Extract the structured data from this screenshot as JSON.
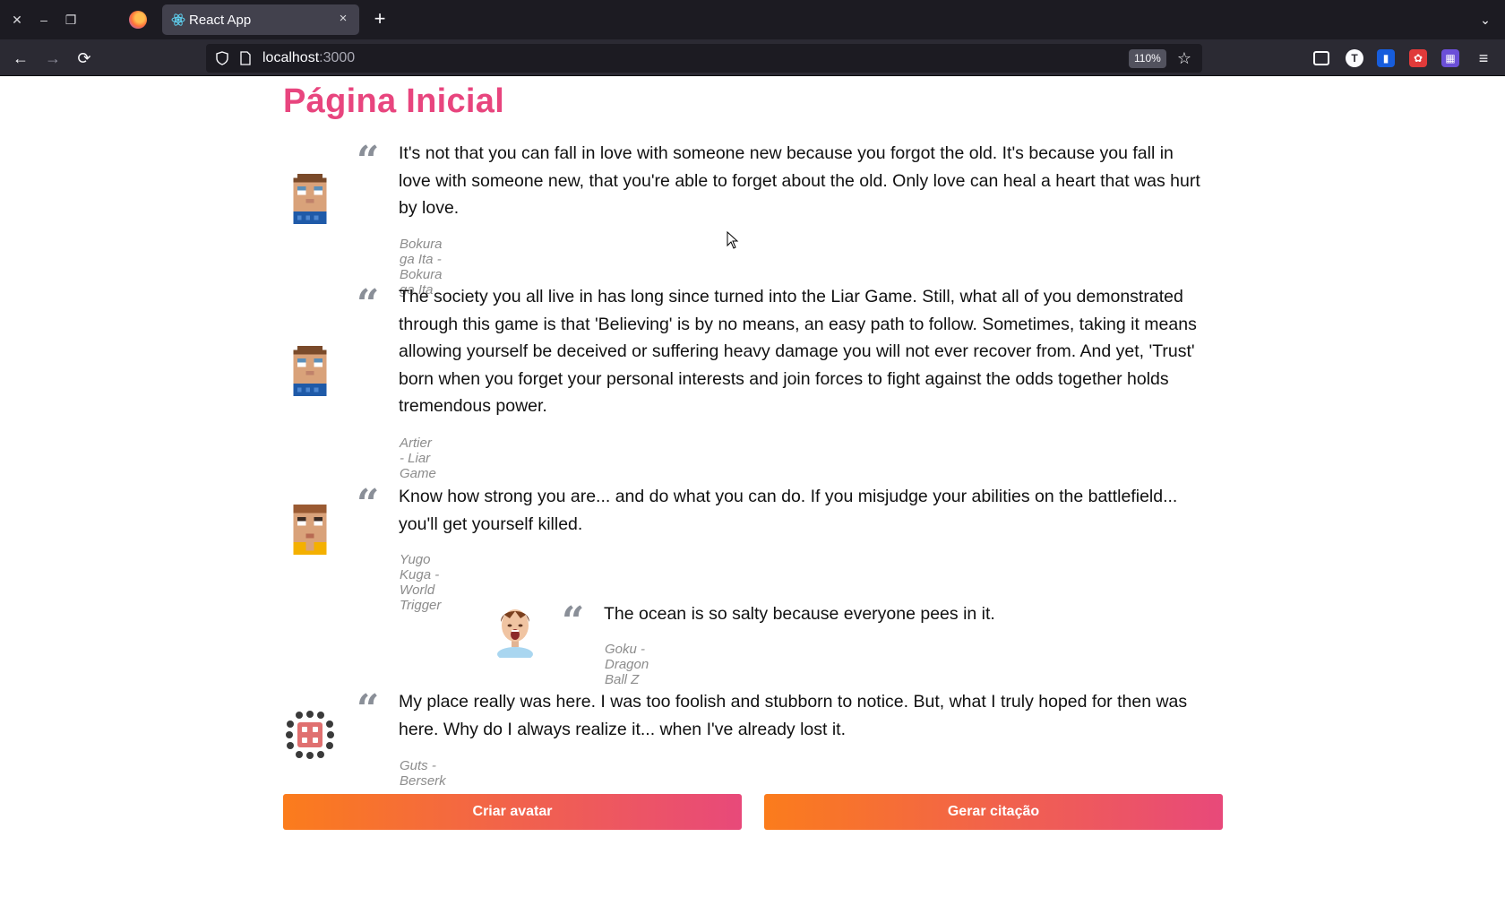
{
  "browser": {
    "tab": {
      "title": "React App"
    },
    "url": {
      "host": "localhost",
      "port": ":3000"
    },
    "zoom": "110%",
    "icons": {
      "close_window": "close-icon",
      "minimize": "minimize-icon",
      "restore": "restore-icon",
      "new_tab": "+",
      "tab_close": "×",
      "back": "←",
      "forward": "→",
      "reload": "⟳",
      "bookmark": "☆",
      "menu": "≡",
      "list_tabs": "⌄"
    }
  },
  "page": {
    "title": "Página Inicial",
    "quotes": [
      {
        "text": "It's not that you can fall in love with someone new because you forgot the old. It's because you fall in love with someone new, that you're able to forget about the old. Only love can heal a heart that was hurt by love.",
        "author": "Bokura ga Ita - Bokura ga Ita"
      },
      {
        "text": "The society you all live in has long since turned into the Liar Game. Still, what all of you demonstrated through this game is that 'Believing' is by no means, an easy path to follow. Sometimes, taking it means allowing yourself be deceived or suffering heavy damage you will not ever recover from. And yet, 'Trust' born when you forget your personal interests and join forces to fight against the odds together holds tremendous power.",
        "author": "Artier - Liar Game"
      },
      {
        "text": "Know how strong you are... and do what you can do. If you misjudge your abilities on the battlefield... you'll get yourself killed.",
        "author": "Yugo Kuga - World Trigger"
      },
      {
        "text": "The ocean is so salty because everyone pees in it.",
        "author": "Goku - Dragon Ball Z"
      },
      {
        "text": "My place really was here. I was too foolish and stubborn to notice. But, what I truly hoped for then was here. Why do I always realize it... when I've already lost it.",
        "author": "Guts - Berserk"
      }
    ],
    "buttons": {
      "create_avatar": "Criar avatar",
      "generate_quote": "Gerar citação"
    },
    "quote_glyph": "“"
  },
  "colors": {
    "title": "#e8457e",
    "button_gradient_start": "#fb7c1c",
    "button_gradient_end": "#e8497a",
    "quote_mark": "#8a8f98",
    "author": "#8c8c8c"
  }
}
